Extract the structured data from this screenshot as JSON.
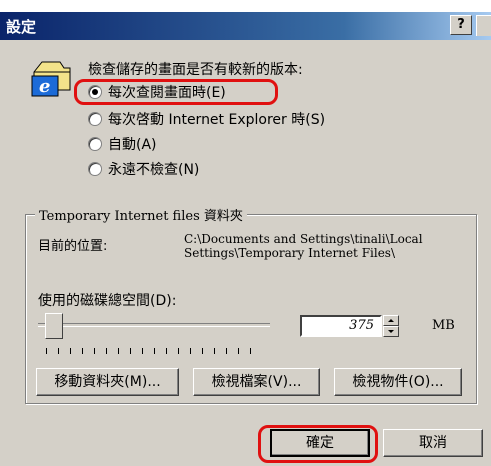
{
  "window": {
    "title": "設定",
    "help_label": "?"
  },
  "check_section": {
    "prompt": "檢查儲存的畫面是否有較新的版本:",
    "options": [
      {
        "label": "每次查閱畫面時(E)",
        "checked": true
      },
      {
        "label": "每次啓動 Internet Explorer 時(S)",
        "checked": false
      },
      {
        "label": "自動(A)",
        "checked": false
      },
      {
        "label": "永遠不檢查(N)",
        "checked": false
      }
    ]
  },
  "temp_files": {
    "group_title": "Temporary Internet files 資料夾",
    "location_label": "目前的位置:",
    "location_value": "C:\\Documents and Settings\\tinali\\Local Settings\\Temporary Internet Files\\",
    "disk_space_label": "使用的磁碟總空間(D):",
    "disk_space_value": "375",
    "disk_space_unit": "MB",
    "buttons": {
      "move": "移動資料夾(M)...",
      "view_files": "檢視檔案(V)...",
      "view_objects": "檢視物件(O)..."
    }
  },
  "footer": {
    "ok_label": "確定",
    "cancel_label": "取消"
  },
  "colors": {
    "titlebar": "#0a246a",
    "face": "#d4d0c8",
    "highlight": "#e01010"
  }
}
